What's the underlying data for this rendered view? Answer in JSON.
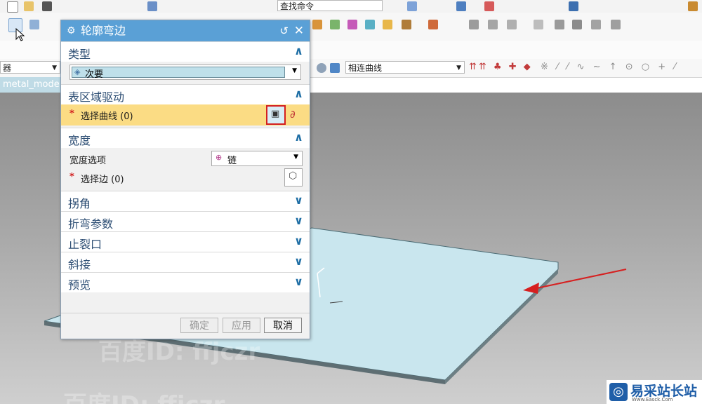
{
  "toolbar": {
    "find_command_placeholder": "查找命令",
    "curve_rule_value": "相连曲线",
    "filter_value": "器"
  },
  "file_tab": {
    "label": "metal_mode"
  },
  "dialog": {
    "title": "轮廓弯边",
    "sections": {
      "type": {
        "title": "类型",
        "dropdown_value": "次要"
      },
      "region": {
        "title": "表区域驱动",
        "select_curve_label": "选择曲线 (0)"
      },
      "width": {
        "title": "宽度",
        "option_label": "宽度选项",
        "option_value": "链",
        "select_edge_label": "选择边 (0)"
      },
      "miter": {
        "title": "拐角"
      },
      "bend": {
        "title": "折弯参数"
      },
      "relief": {
        "title": "止裂口"
      },
      "bevel": {
        "title": "斜接"
      },
      "preview": {
        "title": "预览"
      }
    },
    "buttons": {
      "ok": "确定",
      "apply": "应用",
      "cancel": "取消"
    }
  },
  "watermark": {
    "text": "百度ID: ffjczr"
  },
  "logo": {
    "text": "易采站长站",
    "sub": "Www.Easck.Com"
  }
}
